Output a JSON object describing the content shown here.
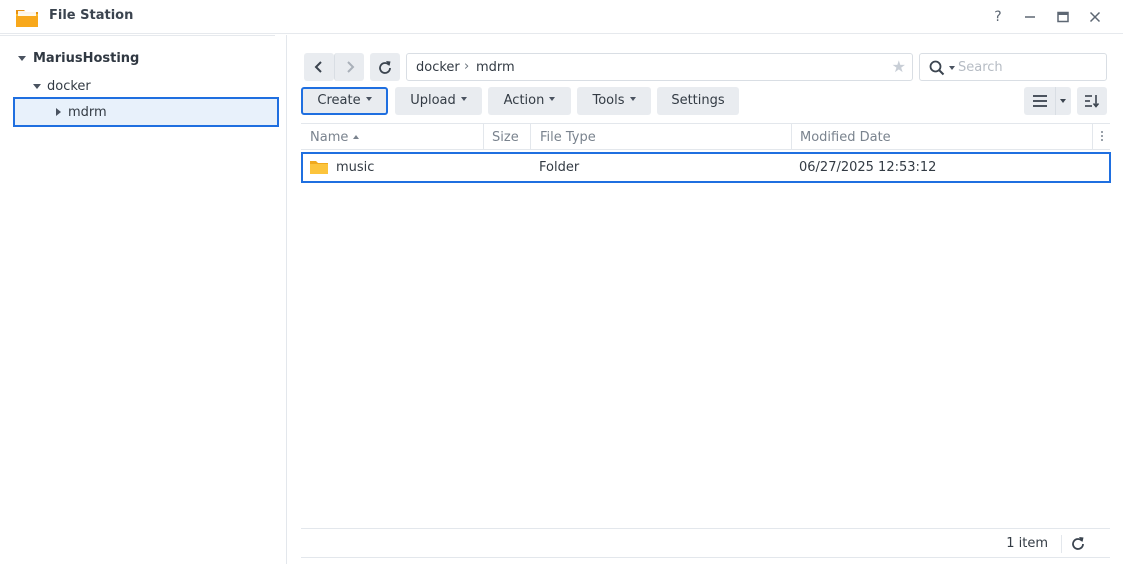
{
  "window": {
    "title": "File Station",
    "help_label": "?",
    "minimize_icon": "minimize-icon",
    "maximize_icon": "maximize-icon",
    "close_icon": "close-icon"
  },
  "sidebar": {
    "root": {
      "label": "MariusHosting",
      "icon": "caret-down-icon"
    },
    "items": [
      {
        "label": "docker",
        "icon": "caret-down-icon"
      },
      {
        "label": "mdrm",
        "icon": "caret-right-icon",
        "selected": true
      }
    ]
  },
  "navigation": {
    "back_icon": "chevron-left-icon",
    "forward_icon": "chevron-right-icon",
    "refresh_icon": "refresh-icon",
    "path": [
      "docker",
      "mdrm"
    ],
    "path_separator": "›",
    "favorite_icon": "star-icon"
  },
  "search": {
    "placeholder": "Search",
    "value": "",
    "icon": "search-icon"
  },
  "toolbar": {
    "buttons": [
      {
        "label": "Create",
        "dropdown": true
      },
      {
        "label": "Upload",
        "dropdown": true
      },
      {
        "label": "Action",
        "dropdown": true
      },
      {
        "label": "Tools",
        "dropdown": true
      },
      {
        "label": "Settings",
        "dropdown": false
      }
    ],
    "view_icon": "list-view-icon",
    "sort_icon": "sort-icon"
  },
  "grid": {
    "columns": [
      "Name",
      "Size",
      "File Type",
      "Modified Date"
    ],
    "sort_column": "Name",
    "sort_direction": "ascending",
    "rows": [
      {
        "icon": "folder-icon",
        "name": "music",
        "size": "",
        "type": "Folder",
        "modified": "06/27/2025 12:53:12"
      }
    ]
  },
  "footer": {
    "count_label": "1 item",
    "refresh_icon": "refresh-icon"
  },
  "colors": {
    "accent": "#1f6fe0",
    "folder": "#f5b82e",
    "button_bg": "#e9ecf0",
    "selection_bg": "#e8f1fb"
  }
}
